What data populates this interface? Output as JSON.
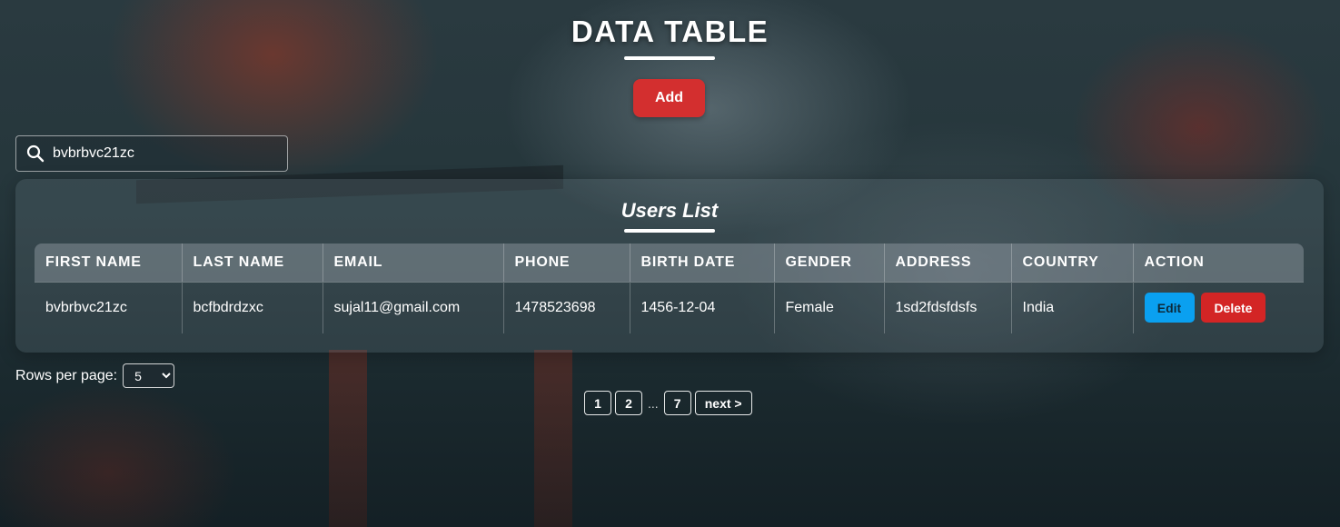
{
  "header": {
    "title": "DATA TABLE",
    "add_label": "Add"
  },
  "search": {
    "value": "bvbrbvc21zc",
    "icon": "search-icon"
  },
  "card": {
    "title": "Users List"
  },
  "table": {
    "columns": [
      "FIRST NAME",
      "LAST NAME",
      "EMAIL",
      "PHONE",
      "BIRTH DATE",
      "GENDER",
      "ADDRESS",
      "COUNTRY",
      "ACTION"
    ],
    "rows": [
      {
        "first_name": "bvbrbvc21zc",
        "last_name": "bcfbdrdzxc",
        "email": "sujal11@gmail.com",
        "phone": "1478523698",
        "birth_date": "1456-12-04",
        "gender": "Female",
        "address": "1sd2fdsfdsfs",
        "country": "India",
        "edit_label": "Edit",
        "delete_label": "Delete"
      }
    ]
  },
  "footer": {
    "rows_per_page_label": "Rows per page:",
    "rows_per_page_value": "5",
    "pages": [
      "1",
      "2",
      "7"
    ],
    "ellipsis": "...",
    "next_label": "next >"
  },
  "colors": {
    "add_button": "#d32f2f",
    "edit_button": "#0aa0f0",
    "delete_button": "#d32525"
  }
}
